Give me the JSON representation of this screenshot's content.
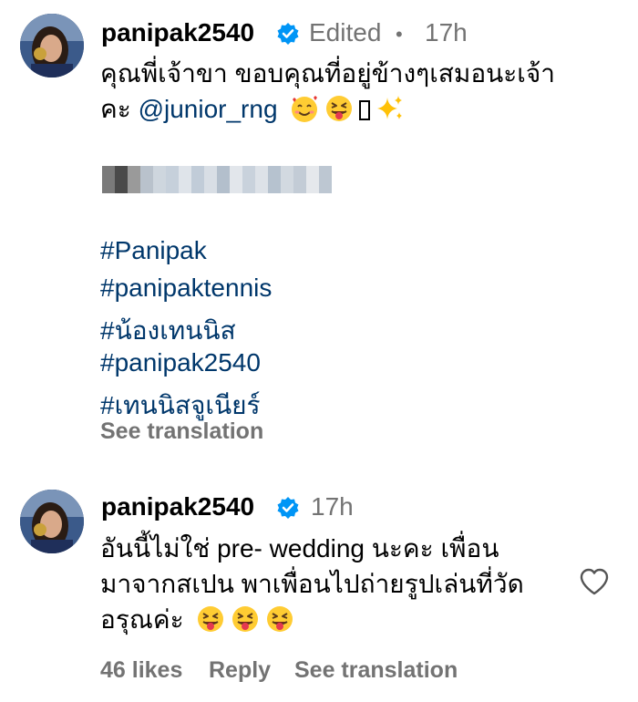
{
  "comment1": {
    "username": "panipak2540",
    "edited": "Edited",
    "separator": "•",
    "time": "17h",
    "line1": "คุณพี่เจ้าขา ขอบคุณที่อยู่ข้างๆเสมอนะเจ้า",
    "line2_prefix": "คะ ",
    "mention": "@junior_rng",
    "emojis": [
      "smiling-face-with-hearts-emoji",
      "squinting-face-with-tongue-emoji",
      "missing-glyph",
      "sparkles-emoji"
    ],
    "hashtags": [
      "#Panipak",
      "#panipaktennis",
      "#น้องเทนนิส",
      "#panipak2540",
      "#เทนนิสจูเนียร์"
    ],
    "see_translation": "See translation"
  },
  "comment2": {
    "username": "panipak2540",
    "time": "17h",
    "lines": [
      "อันนี้ไม่ใช่ pre- wedding นะคะ เพื่อน",
      "มาจากสเปน พาเพื่อนไปถ่ายรูปเล่นที่วัด",
      "อรุณค่ะ"
    ],
    "emojis": [
      "squinting-face-with-tongue-emoji",
      "squinting-face-with-tongue-emoji",
      "squinting-face-with-tongue-emoji"
    ],
    "likes": "46 likes",
    "reply": "Reply",
    "see_translation": "See translation"
  },
  "colors": {
    "link": "#00376b",
    "secondary": "#737373",
    "verified": "#0095f6"
  }
}
